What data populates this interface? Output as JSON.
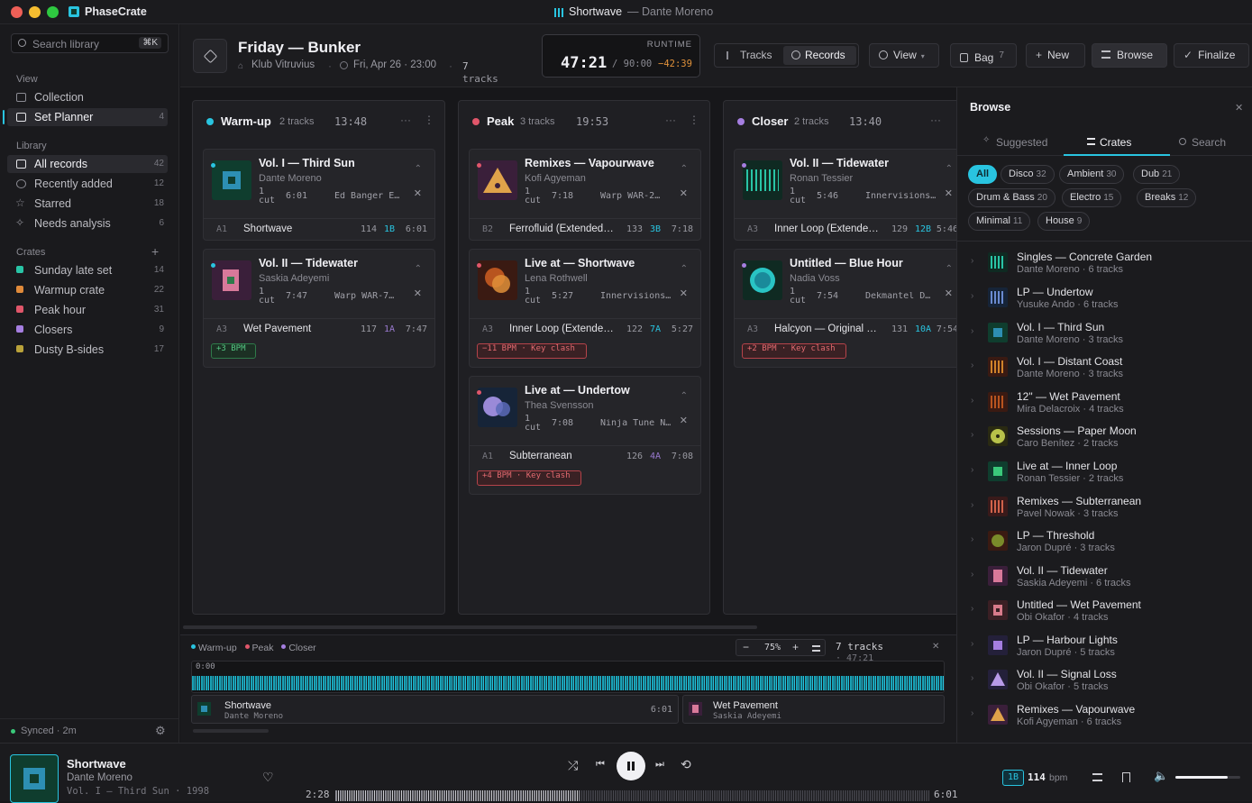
{
  "app": {
    "name": "PhaseCrate",
    "now_playing_title": "Shortwave",
    "now_playing_artist": "— Dante Moreno"
  },
  "sidebar": {
    "search_placeholder": "Search library",
    "shortcut": "⌘K",
    "view_label": "View",
    "view_items": [
      {
        "label": "Collection",
        "count": ""
      },
      {
        "label": "Set Planner",
        "count": "4"
      }
    ],
    "library_label": "Library",
    "library_items": [
      {
        "label": "All records",
        "count": "42"
      },
      {
        "label": "Recently added",
        "count": "12"
      },
      {
        "label": "Starred",
        "count": "18"
      },
      {
        "label": "Needs analysis",
        "count": "6"
      }
    ],
    "crates_label": "Crates",
    "crates_add": "+",
    "crates": [
      {
        "label": "Sunday late set",
        "count": "14",
        "color": "#29c4a6"
      },
      {
        "label": "Warmup crate",
        "count": "22",
        "color": "#e08a3a"
      },
      {
        "label": "Peak hour",
        "count": "31",
        "color": "#e0566a"
      },
      {
        "label": "Closers",
        "count": "9",
        "color": "#a57ee0"
      },
      {
        "label": "Dusty B-sides",
        "count": "17",
        "color": "#b9a23a"
      }
    ],
    "sync_status": "Synced · 2m"
  },
  "header": {
    "set_title": "Friday — Bunker",
    "venue": "Klub Vitruvius",
    "datetime": "Fri, Apr 26 · 23:00",
    "track_count": "7",
    "track_word": "tracks",
    "runtime_label": "RUNTIME",
    "runtime_current": "47:21",
    "runtime_target": "/ 90:00",
    "runtime_diff": "−42:39",
    "seg_tracks": "Tracks",
    "seg_records": "Records",
    "view_btn": "View",
    "bag_btn": "Bag",
    "bag_count": "7",
    "new_btn": "New",
    "browse_btn": "Browse",
    "finalize_btn": "Finalize"
  },
  "groups": [
    {
      "name": "Warm-up",
      "count": "2 tracks",
      "duration": "13:48",
      "color": "#29c4e0",
      "cards": [
        {
          "title": "Vol. I — Third Sun",
          "artist": "Dante Moreno",
          "cut": "1 cut",
          "length": "6:01",
          "label": "Ed Banger E…",
          "pos": "A1",
          "track": "Shortwave",
          "bpm": "114",
          "key": "1B",
          "dur": "6:01",
          "badge": "",
          "art": "#0f3d2e"
        },
        {
          "title": "Vol. II — Tidewater",
          "artist": "Saskia Adeyemi",
          "cut": "1 cut",
          "length": "7:47",
          "label": "Warp WAR-7…",
          "pos": "A3",
          "track": "Wet Pavement",
          "bpm": "117",
          "key": "1A",
          "dur": "7:47",
          "badge": "+3 BPM",
          "art": "#3a1f3a"
        }
      ]
    },
    {
      "name": "Peak",
      "count": "3 tracks",
      "duration": "19:53",
      "color": "#e0566a",
      "cards": [
        {
          "title": "Remixes — Vapourwave",
          "artist": "Kofi Agyeman",
          "cut": "1 cut",
          "length": "7:18",
          "label": "Warp WAR-2…",
          "pos": "B2",
          "track": "Ferrofluid (Extended …",
          "bpm": "133",
          "key": "3B",
          "dur": "7:18",
          "badge": "",
          "art": "#3a1f3a"
        },
        {
          "title": "Live at — Shortwave",
          "artist": "Lena Rothwell",
          "cut": "1 cut",
          "length": "5:27",
          "label": "Innervisions…",
          "pos": "A3",
          "track": "Inner Loop (Extended…",
          "bpm": "122",
          "key": "7A",
          "dur": "5:27",
          "badge": "−11 BPM · Key clash",
          "art": "#3a1a12"
        },
        {
          "title": "Live at — Undertow",
          "artist": "Thea Svensson",
          "cut": "1 cut",
          "length": "7:08",
          "label": "Ninja Tune N…",
          "pos": "A1",
          "track": "Subterranean",
          "bpm": "126",
          "key": "4A",
          "dur": "7:08",
          "badge": "+4 BPM · Key clash",
          "art": "#162438"
        }
      ]
    },
    {
      "name": "Closer",
      "count": "2 tracks",
      "duration": "13:40",
      "color": "#a57ee0",
      "cards": [
        {
          "title": "Vol. II — Tidewater",
          "artist": "Ronan Tessier",
          "cut": "1 cut",
          "length": "5:46",
          "label": "Innervisions…",
          "pos": "A3",
          "track": "Inner Loop (Extende…",
          "bpm": "129",
          "key": "12B",
          "dur": "5:46",
          "badge": "",
          "art": "#0f2a22"
        },
        {
          "title": "Untitled — Blue Hour",
          "artist": "Nadia Voss",
          "cut": "1 cut",
          "length": "7:54",
          "label": "Dekmantel D…",
          "pos": "A3",
          "track": "Halcyon — Original …",
          "bpm": "131",
          "key": "10A",
          "dur": "7:54",
          "badge": "+2 BPM · Key clash",
          "art": "#0f2a22"
        }
      ]
    }
  ],
  "browse": {
    "title": "Browse",
    "tabs": [
      "Suggested",
      "Crates",
      "Search"
    ],
    "chips": [
      {
        "label": "All",
        "count": ""
      },
      {
        "label": "Disco",
        "count": "32"
      },
      {
        "label": "Ambient",
        "count": "30"
      },
      {
        "label": "Dub",
        "count": "21"
      },
      {
        "label": "Drum & Bass",
        "count": "20"
      },
      {
        "label": "Electro",
        "count": "15"
      },
      {
        "label": "Breaks",
        "count": "12"
      },
      {
        "label": "Minimal",
        "count": "11"
      },
      {
        "label": "House",
        "count": "9"
      }
    ],
    "releases": [
      {
        "title": "Singles — Concrete Garden",
        "sub": "Dante Moreno · 6 tracks",
        "color": "#1f6b54"
      },
      {
        "title": "LP — Undertow",
        "sub": "Yusuke Ando · 6 tracks",
        "color": "#2f4f7a"
      },
      {
        "title": "Vol. I — Third Sun",
        "sub": "Dante Moreno · 3 tracks",
        "color": "#2d8fb3"
      },
      {
        "title": "Vol. I — Distant Coast",
        "sub": "Dante Moreno · 3 tracks",
        "color": "#a0622a"
      },
      {
        "title": "12\" — Wet Pavement",
        "sub": "Mira Delacroix · 4 tracks",
        "color": "#8a4a2a"
      },
      {
        "title": "Sessions — Paper Moon",
        "sub": "Caro Benítez · 2 tracks",
        "color": "#9aa23a"
      },
      {
        "title": "Live at — Inner Loop",
        "sub": "Ronan Tessier · 2 tracks",
        "color": "#2f8a4a"
      },
      {
        "title": "Remixes — Subterranean",
        "sub": "Pavel Nowak · 3 tracks",
        "color": "#a04a4a"
      },
      {
        "title": "LP — Threshold",
        "sub": "Jaron Dupré · 3 tracks",
        "color": "#7a8a2a"
      },
      {
        "title": "Vol. II — Tidewater",
        "sub": "Saskia Adeyemi · 6 tracks",
        "color": "#b36a8a"
      },
      {
        "title": "Untitled — Wet Pavement",
        "sub": "Obi Okafor · 4 tracks",
        "color": "#b35a6a"
      },
      {
        "title": "LP — Harbour Lights",
        "sub": "Jaron Dupré · 5 tracks",
        "color": "#8a6ab3"
      },
      {
        "title": "Vol. II — Signal Loss",
        "sub": "Obi Okafor · 5 tracks",
        "color": "#9a7ad0"
      },
      {
        "title": "Remixes — Vapourwave",
        "sub": "Kofi Agyeman · 6 tracks",
        "color": "#d09a3a"
      }
    ]
  },
  "timeline": {
    "legend": [
      "Warm-up",
      "Peak",
      "Closer"
    ],
    "zoom": "75%",
    "tracks_summary": "7 tracks",
    "total_time": "· 47:21",
    "start_time": "0:00",
    "clips": [
      {
        "title": "Shortwave",
        "artist": "Dante Moreno",
        "dur": "6:01"
      },
      {
        "title": "Wet Pavement",
        "artist": "Saskia Adeyemi",
        "dur": ""
      }
    ]
  },
  "player": {
    "title": "Shortwave",
    "artist": "Dante Moreno",
    "release": "Vol. I — Third Sun · 1998",
    "elapsed": "2:28",
    "total": "6:01",
    "key": "1B",
    "bpm": "114",
    "bpm_unit": "bpm",
    "progress": 0.41,
    "volume": 0.8
  }
}
